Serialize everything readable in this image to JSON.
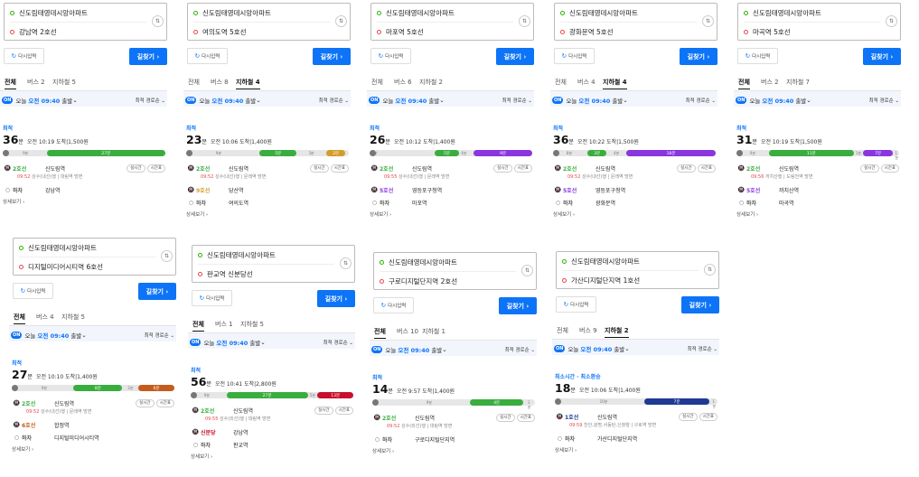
{
  "ui": {
    "reset_label": "다시입력",
    "find_label": "길찾기 ›",
    "status_prefix": "오늘",
    "depart_time": "오전 09:40",
    "depart_suffix": "출발",
    "sort_label": "최적 경로순",
    "realtime_label": "실시간",
    "timetable_label": "시간표",
    "alight_label": "하차",
    "more_label": "상세보기 ›",
    "on_label": "ON",
    "min_unit": "분"
  },
  "cards": [
    {
      "origin": "신도림태영데시앙아파트",
      "dest": "강남역 2호선",
      "tabs": [
        {
          "label": "전체",
          "active": true
        },
        {
          "label": "버스 2",
          "active": false
        },
        {
          "label": "지하철 5",
          "active": false
        }
      ],
      "best": "최적",
      "minutes": "36",
      "arrive": "오전 10:19 도착",
      "fare": "1,500원",
      "segs": [
        {
          "color": "#3aad3f",
          "start": 0.27,
          "end": 1.0,
          "label": "27분"
        }
      ],
      "bar_labels": [
        {
          "text": "9분",
          "pos": 0.14
        }
      ],
      "legs": [
        {
          "icon": "🚇",
          "line": "2호선",
          "line_color": "#3aad3f",
          "station": "신도림역",
          "buttons": true,
          "details": [
            {
              "text": "09:52",
              "red": true
            },
            {
              "text": " 성수(내선)행 | 대림역 방면"
            }
          ]
        },
        {
          "icon": "○",
          "line": "하차",
          "line_color": "#555",
          "station": "강남역",
          "buttons": false
        }
      ]
    },
    {
      "origin": "신도림태영데시앙아파트",
      "dest": "여의도역 5호선",
      "tabs": [
        {
          "label": "전체",
          "active": false
        },
        {
          "label": "버스 8",
          "active": false
        },
        {
          "label": "지하철 4",
          "active": true
        }
      ],
      "best": "최적",
      "minutes": "23",
      "arrive": "오전 10:06 도착",
      "fare": "1,400원",
      "segs": [
        {
          "color": "#3aad3f",
          "start": 0.45,
          "end": 0.68,
          "label": "5분"
        },
        {
          "color": "#d39c2b",
          "start": 0.86,
          "end": 0.98,
          "label": "2분"
        }
      ],
      "bar_labels": [
        {
          "text": "9분",
          "pos": 0.2
        },
        {
          "text": "3분",
          "pos": 0.77
        },
        {
          "text": "1분",
          "pos": 0.93
        }
      ],
      "legs": [
        {
          "icon": "🚇",
          "line": "2호선",
          "line_color": "#3aad3f",
          "station": "신도림역",
          "buttons": true,
          "details": [
            {
              "text": "09:52",
              "red": true
            },
            {
              "text": " 성수(내선)행 | 문래역 방면"
            }
          ]
        },
        {
          "icon": "🚇",
          "line": "9호선",
          "line_color": "#d39c2b",
          "station": "당산역",
          "buttons": false
        },
        {
          "icon": "○",
          "line": "하차",
          "line_color": "#555",
          "station": "여의도역",
          "buttons": false
        }
      ]
    },
    {
      "origin": "신도림태영데시앙아파트",
      "dest": "마포역 5호선",
      "tabs": [
        {
          "label": "전체",
          "active": false
        },
        {
          "label": "버스 6",
          "active": false
        },
        {
          "label": "지하철 2",
          "active": false
        }
      ],
      "best": "최적",
      "minutes": "26",
      "arrive": "오전 10:12 도착",
      "fare": "1,400원",
      "segs": [
        {
          "color": "#3aad3f",
          "start": 0.4,
          "end": 0.55,
          "label": "5분"
        },
        {
          "color": "#8936e0",
          "start": 0.64,
          "end": 1.0,
          "label": "9분"
        }
      ],
      "bar_labels": [
        {
          "text": "6분",
          "pos": 0.03
        },
        {
          "text": "4분",
          "pos": 0.58
        }
      ],
      "legs": [
        {
          "icon": "🚇",
          "line": "2호선",
          "line_color": "#3aad3f",
          "station": "신도림역",
          "buttons": true,
          "details": [
            {
              "text": "09:55",
              "red": true
            },
            {
              "text": " 성수(내선)행 | 문래역 방면"
            }
          ]
        },
        {
          "icon": "🚇",
          "line": "5호선",
          "line_color": "#8936e0",
          "station": "영등포구청역",
          "buttons": false
        },
        {
          "icon": "○",
          "line": "하차",
          "line_color": "#555",
          "station": "마포역",
          "buttons": false
        }
      ]
    },
    {
      "origin": "신도림태영데시앙아파트",
      "dest": "광화문역 5호선",
      "tabs": [
        {
          "label": "전체",
          "active": false
        },
        {
          "label": "버스 4",
          "active": false
        },
        {
          "label": "지하철 4",
          "active": true
        }
      ],
      "best": "최적",
      "minutes": "36",
      "arrive": "오전 10:22 도착",
      "fare": "1,500원",
      "segs": [
        {
          "color": "#3aad3f",
          "start": 0.21,
          "end": 0.33,
          "label": "3분"
        },
        {
          "color": "#8936e0",
          "start": 0.45,
          "end": 1.0,
          "label": "18분"
        }
      ],
      "bar_labels": [
        {
          "text": "8분",
          "pos": 0.1
        },
        {
          "text": "4분",
          "pos": 0.39
        }
      ],
      "legs": [
        {
          "icon": "🚇",
          "line": "2호선",
          "line_color": "#3aad3f",
          "station": "신도림역",
          "buttons": true,
          "details": [
            {
              "text": "09:52",
              "red": true
            },
            {
              "text": " 성수(내선)행 | 문래역 방면"
            }
          ]
        },
        {
          "icon": "🚇",
          "line": "5호선",
          "line_color": "#8936e0",
          "station": "영등포구청역",
          "buttons": false
        },
        {
          "icon": "○",
          "line": "하차",
          "line_color": "#555",
          "station": "광화문역",
          "buttons": false
        }
      ]
    },
    {
      "origin": "신도림태영데시앙아파트",
      "dest": "마곡역 5호선",
      "tabs": [
        {
          "label": "전체",
          "active": true
        },
        {
          "label": "버스 2",
          "active": false
        },
        {
          "label": "지하철 7",
          "active": false
        }
      ],
      "best": "최적",
      "minutes": "31",
      "arrive": "오전 10:19 도착",
      "fare": "1,500원",
      "segs": [
        {
          "color": "#3aad3f",
          "start": 0.2,
          "end": 0.72,
          "label": "11분"
        },
        {
          "color": "#8936e0",
          "start": 0.78,
          "end": 0.96,
          "label": "7분"
        }
      ],
      "bar_labels": [
        {
          "text": "9분",
          "pos": 0.1
        },
        {
          "text": "1분",
          "pos": 0.75
        },
        {
          "text": "1분",
          "pos": 0.985
        }
      ],
      "legs": [
        {
          "icon": "🚇",
          "line": "2호선",
          "line_color": "#3aad3f",
          "station": "신도림역",
          "buttons": true,
          "details": [
            {
              "text": "09:56",
              "red": true
            },
            {
              "text": " 까치산행 | 도림천역 방면"
            }
          ]
        },
        {
          "icon": "🚇",
          "line": "5호선",
          "line_color": "#8936e0",
          "station": "까치산역",
          "buttons": false
        },
        {
          "icon": "○",
          "line": "하차",
          "line_color": "#555",
          "station": "마곡역",
          "buttons": false
        }
      ]
    },
    {
      "origin": "신도림태영데시앙아파트",
      "dest": "디지털미디어시티역 6호선",
      "tabs": [
        {
          "label": "전체",
          "active": true
        },
        {
          "label": "버스 4",
          "active": false
        },
        {
          "label": "지하철 5",
          "active": false
        }
      ],
      "best": "최적",
      "minutes": "27",
      "arrive": "오전 10:10 도착",
      "fare": "1,400원",
      "segs": [
        {
          "color": "#3aad3f",
          "start": 0.38,
          "end": 0.68,
          "label": "8분"
        },
        {
          "color": "#c55c1d",
          "start": 0.78,
          "end": 1.0,
          "label": "6분"
        }
      ],
      "bar_labels": [
        {
          "text": "9분",
          "pos": 0.2
        },
        {
          "text": "2분",
          "pos": 0.73
        }
      ],
      "legs": [
        {
          "icon": "🚇",
          "line": "2호선",
          "line_color": "#3aad3f",
          "station": "신도림역",
          "buttons": true,
          "details": [
            {
              "text": "09:52",
              "red": true
            },
            {
              "text": " 성수(내선)행 | 문래역 방면"
            }
          ]
        },
        {
          "icon": "🚇",
          "line": "6호선",
          "line_color": "#c55c1d",
          "station": "합정역",
          "buttons": false
        },
        {
          "icon": "○",
          "line": "하차",
          "line_color": "#555",
          "station": "디지털미디어시티역",
          "buttons": false
        }
      ]
    },
    {
      "origin": "신도림태영데시앙아파트",
      "dest": "판교역 신분당선",
      "tabs": [
        {
          "label": "전체",
          "active": true
        },
        {
          "label": "버스 1",
          "active": false
        },
        {
          "label": "지하철 5",
          "active": false
        }
      ],
      "best": "최적",
      "minutes": "56",
      "arrive": "오전 10:41 도착",
      "fare": "2,800원",
      "segs": [
        {
          "color": "#3aad3f",
          "start": 0.22,
          "end": 0.72,
          "label": "27분"
        },
        {
          "color": "#c8102e",
          "start": 0.78,
          "end": 1.0,
          "label": "13분"
        }
      ],
      "bar_labels": [
        {
          "text": "9분",
          "pos": 0.1
        },
        {
          "text": "5분",
          "pos": 0.75
        }
      ],
      "legs": [
        {
          "icon": "🚇",
          "line": "2호선",
          "line_color": "#3aad3f",
          "station": "신도림역",
          "buttons": true,
          "details": [
            {
              "text": "09:55",
              "red": true
            },
            {
              "text": " 성수(외선)행 | 대림역 방면"
            }
          ]
        },
        {
          "icon": "🚇",
          "line": "신분당",
          "line_color": "#c8102e",
          "station": "강남역",
          "buttons": false
        },
        {
          "icon": "○",
          "line": "하차",
          "line_color": "#555",
          "station": "판교역",
          "buttons": false
        }
      ]
    },
    {
      "origin": "신도림태영데시앙아파트",
      "dest": "구로디지털단지역 2호선",
      "tabs": [
        {
          "label": "전체",
          "active": true
        },
        {
          "label": "버스 10",
          "active": false
        },
        {
          "label": "지하철 1",
          "active": false
        }
      ],
      "best": "최적",
      "minutes": "14",
      "arrive": "오전 9:57 도착",
      "fare": "1,400원",
      "segs": [
        {
          "color": "#3aad3f",
          "start": 0.6,
          "end": 0.93,
          "label": "4분"
        }
      ],
      "bar_labels": [
        {
          "text": "9분",
          "pos": 0.35
        },
        {
          "text": "1분",
          "pos": 0.97
        }
      ],
      "legs": [
        {
          "icon": "🚇",
          "line": "2호선",
          "line_color": "#3aad3f",
          "station": "신도림역",
          "buttons": true,
          "details": [
            {
              "text": "09:52",
              "red": true
            },
            {
              "text": " 성수(외선)행 | 대림역 방면"
            }
          ]
        },
        {
          "icon": "○",
          "line": "하차",
          "line_color": "#555",
          "station": "구로디지털단지역",
          "buttons": false
        }
      ]
    },
    {
      "origin": "신도림태영데시앙아파트",
      "dest": "가산디지털단지역 1호선",
      "tabs": [
        {
          "label": "전체",
          "active": false
        },
        {
          "label": "버스 9",
          "active": false
        },
        {
          "label": "지하철 2",
          "active": true
        }
      ],
      "best": "최소시간 · 최소환승",
      "minutes": "18",
      "arrive": "오전 10:06 도착",
      "fare": "1,400원",
      "segs": [
        {
          "color": "#1f3a93",
          "start": 0.55,
          "end": 0.95,
          "label": "7분"
        }
      ],
      "bar_labels": [
        {
          "text": "10분",
          "pos": 0.3
        },
        {
          "text": "1분",
          "pos": 0.98
        }
      ],
      "legs": [
        {
          "icon": "🚇",
          "line": "1호선",
          "line_color": "#1f3a93",
          "station": "신도림역",
          "buttons": true,
          "details": [
            {
              "text": "09:59",
              "red": true
            },
            {
              "text": " 천안,광명,서동탄,신창행 | 구로역 방면"
            }
          ]
        },
        {
          "icon": "○",
          "line": "하차",
          "line_color": "#555",
          "station": "가산디지털단지역",
          "buttons": false
        }
      ]
    }
  ]
}
